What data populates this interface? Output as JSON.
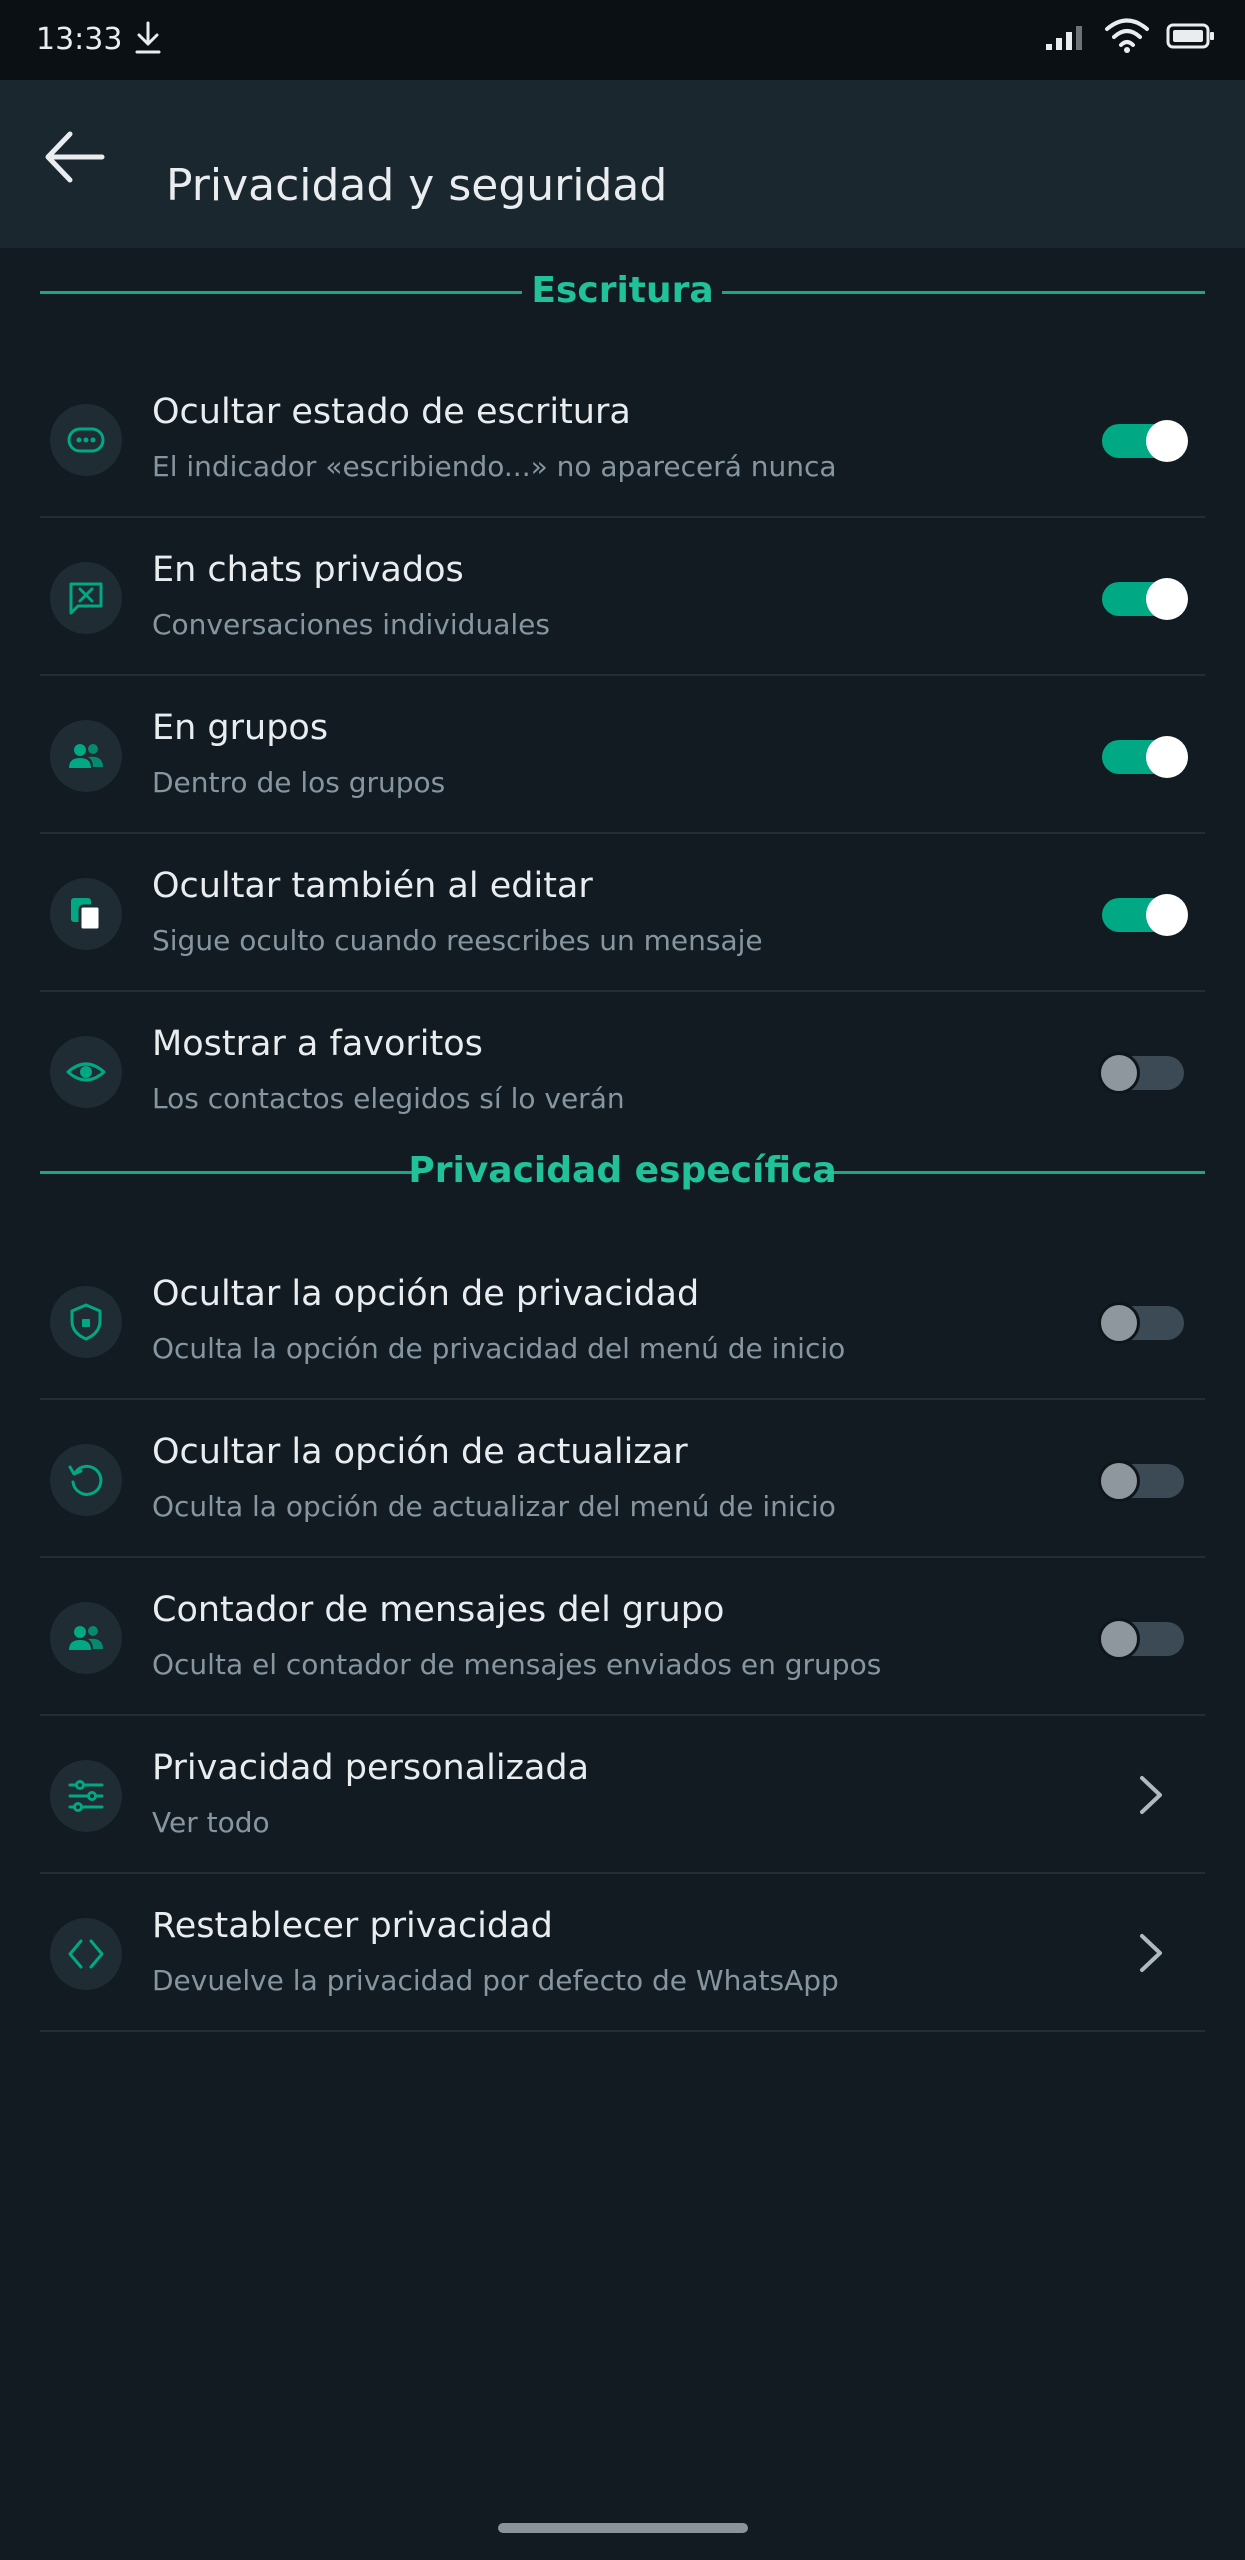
{
  "status_bar": {
    "time": "13:33"
  },
  "header": {
    "title": "Privacidad y seguridad"
  },
  "sections": [
    {
      "title": "Escritura",
      "rows": [
        {
          "title": "Ocultar estado de escritura",
          "subtitle": "El indicador «escribiendo...» no aparecerá nunca",
          "icon": "typing-bubble-icon",
          "control": "toggle",
          "enabled": true
        },
        {
          "title": "En chats privados",
          "subtitle": "Conversaciones individuales",
          "icon": "chat-cross-icon",
          "control": "toggle",
          "enabled": true
        },
        {
          "title": "En grupos",
          "subtitle": "Dentro de los grupos",
          "icon": "group-icon",
          "control": "toggle",
          "enabled": true
        },
        {
          "title": "Ocultar también al editar",
          "subtitle": "Sigue oculto cuando reescribes un mensaje",
          "icon": "copy-icon",
          "control": "toggle",
          "enabled": true
        },
        {
          "title": "Mostrar a favoritos",
          "subtitle": "Los contactos elegidos sí lo verán",
          "icon": "eye-icon",
          "control": "toggle",
          "enabled": false
        }
      ]
    },
    {
      "title": "Privacidad específica",
      "rows": [
        {
          "title": "Ocultar la opción de privacidad",
          "subtitle": "Oculta la opción de privacidad del menú de inicio",
          "icon": "shield-icon",
          "control": "toggle",
          "enabled": false
        },
        {
          "title": "Ocultar la opción de actualizar",
          "subtitle": "Oculta la opción de actualizar del menú de inicio",
          "icon": "refresh-icon",
          "control": "toggle",
          "enabled": false
        },
        {
          "title": "Contador de mensajes del grupo",
          "subtitle": "Oculta el contador de mensajes enviados en grupos",
          "icon": "group-icon",
          "control": "toggle",
          "enabled": false
        },
        {
          "title": "Privacidad personalizada",
          "subtitle": "Ver todo",
          "icon": "sliders-icon",
          "control": "chevron"
        },
        {
          "title": "Restablecer privacidad",
          "subtitle": "Devuelve la privacidad por defecto de WhatsApp",
          "icon": "code-brackets-icon",
          "control": "chevron"
        }
      ]
    }
  ],
  "colors": {
    "accent": "#00a884",
    "section_title": "#21c29a",
    "background": "#111b21",
    "app_bar": "#1b272e"
  }
}
